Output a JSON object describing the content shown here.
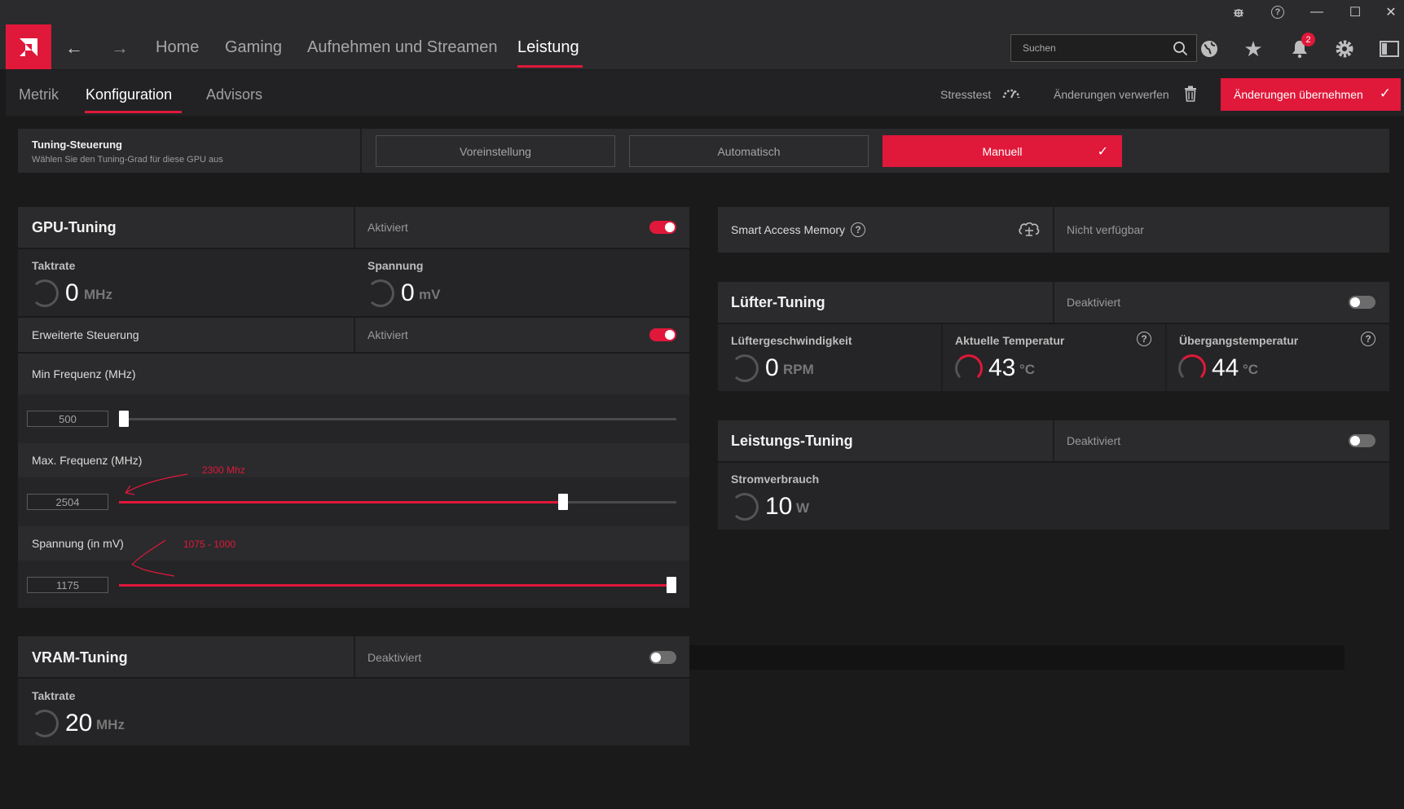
{
  "window": {
    "controls": {
      "bug": "bug-icon",
      "help": "?",
      "minimize": "—",
      "maximize": "☐",
      "close": "✕"
    }
  },
  "nav": {
    "back": "←",
    "forward": "→",
    "items": [
      {
        "label": "Home"
      },
      {
        "label": "Gaming"
      },
      {
        "label": "Aufnehmen und Streamen"
      },
      {
        "label": "Leistung"
      }
    ],
    "search_placeholder": "Suchen",
    "notification_count": "2",
    "accent": "#e0183a"
  },
  "subnav": {
    "items": [
      {
        "label": "Metrik"
      },
      {
        "label": "Konfiguration"
      },
      {
        "label": "Advisors"
      }
    ],
    "stresstest": "Stresstest",
    "discard": "Änderungen verwerfen",
    "apply": "Änderungen übernehmen"
  },
  "tuning_control": {
    "title": "Tuning-Steuerung",
    "subtitle": "Wählen Sie den Tuning-Grad für diese GPU aus",
    "options": [
      "Voreinstellung",
      "Automatisch",
      "Manuell"
    ],
    "selected": "Manuell"
  },
  "gpu_tuning": {
    "title": "GPU-Tuning",
    "status": "Aktiviert",
    "enabled": true,
    "clock": {
      "label": "Taktrate",
      "value": "0",
      "unit": "MHz"
    },
    "voltage": {
      "label": "Spannung",
      "value": "0",
      "unit": "mV"
    },
    "advanced": {
      "label": "Erweiterte Steuerung",
      "status": "Aktiviert",
      "enabled": true
    },
    "min_freq": {
      "label": "Min Frequenz (MHz)",
      "value": "500",
      "fraction": 0.0
    },
    "max_freq": {
      "label": "Max. Frequenz (MHz)",
      "value": "2504",
      "fraction": 0.795,
      "annotation": "2300 Mhz"
    },
    "voltage_slider": {
      "label": "Spannung (in mV)",
      "value": "1175",
      "fraction": 1.0,
      "annotation": "1075 - 1000"
    }
  },
  "vram_tuning": {
    "title": "VRAM-Tuning",
    "status": "Deaktiviert",
    "enabled": false,
    "clock": {
      "label": "Taktrate",
      "value": "20",
      "unit": "MHz"
    }
  },
  "smart_access_memory": {
    "label": "Smart Access Memory",
    "status": "Nicht verfügbar"
  },
  "fan_tuning": {
    "title": "Lüfter-Tuning",
    "status": "Deaktiviert",
    "enabled": false,
    "fan_speed": {
      "label": "Lüftergeschwindigkeit",
      "value": "0",
      "unit": "RPM"
    },
    "current_temp": {
      "label": "Aktuelle Temperatur",
      "value": "43",
      "unit": "°C"
    },
    "junction_temp": {
      "label": "Übergangstemperatur",
      "value": "44",
      "unit": "°C"
    }
  },
  "power_tuning": {
    "title": "Leistungs-Tuning",
    "status": "Deaktiviert",
    "enabled": false,
    "power": {
      "label": "Stromverbrauch",
      "value": "10",
      "unit": "W"
    }
  }
}
